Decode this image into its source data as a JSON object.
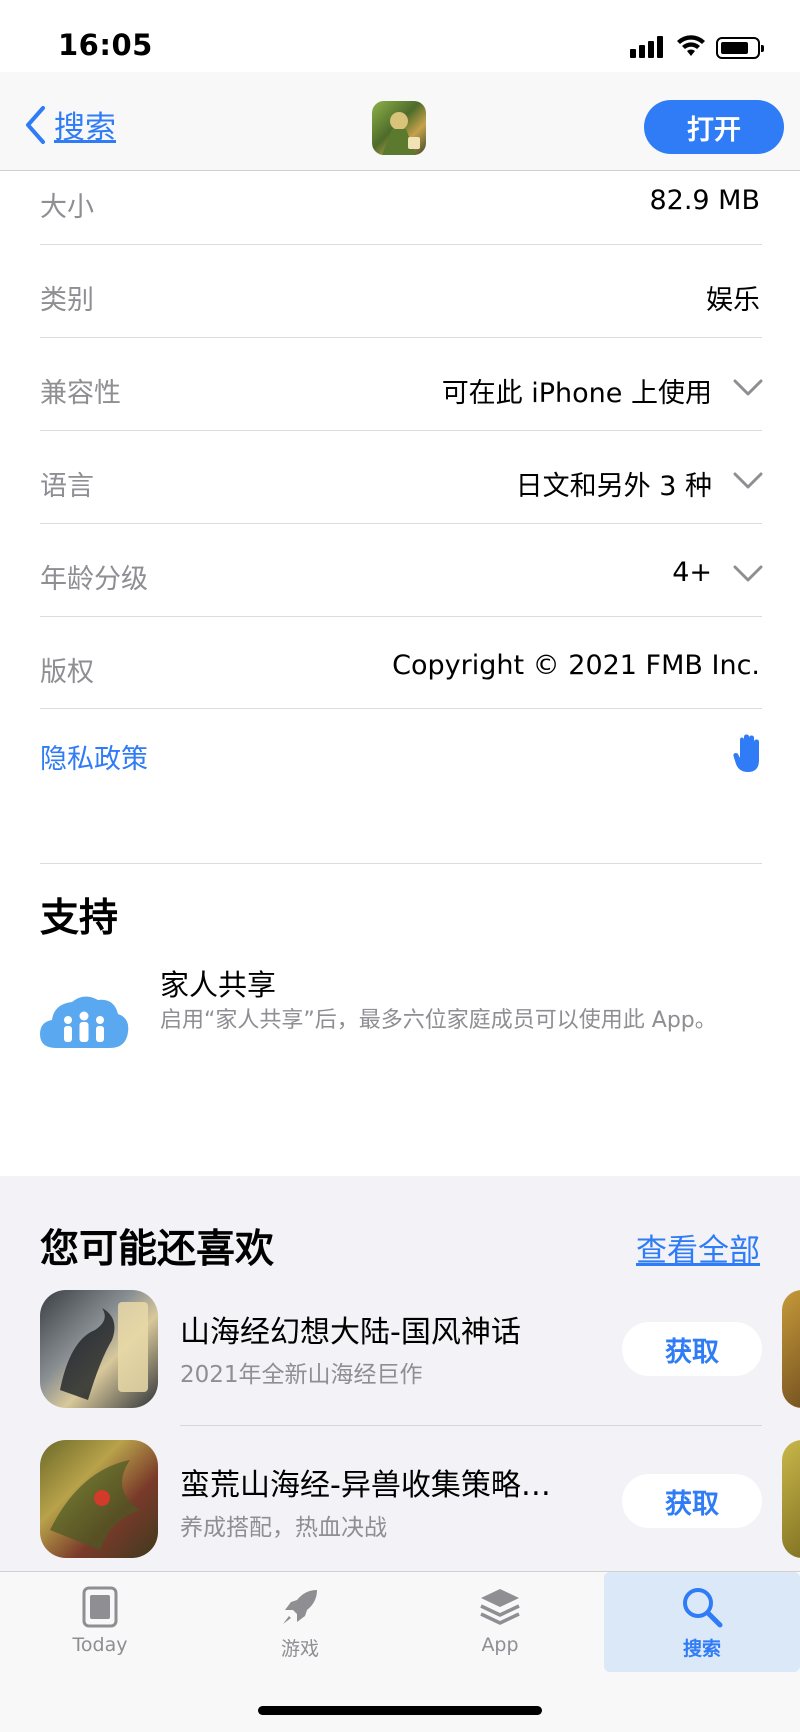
{
  "status_bar": {
    "time": "16:05"
  },
  "nav": {
    "back_label": "搜索",
    "open_label": "打开"
  },
  "info": {
    "rows": [
      {
        "label": "大小",
        "value": "82.9 MB"
      },
      {
        "label": "类别",
        "value": "娱乐"
      },
      {
        "label": "兼容性",
        "value": "可在此 iPhone 上使用"
      },
      {
        "label": "语言",
        "value": "日文和另外 3 种"
      },
      {
        "label": "年龄分级",
        "value": "4+"
      },
      {
        "label": "版权",
        "value": "Copyright © 2021 FMB Inc."
      }
    ],
    "privacy_label": "隐私政策"
  },
  "support": {
    "title": "支持",
    "family_title": "家人共享",
    "family_desc": "启用“家人共享”后，最多六位家庭成员可以使用此 App。"
  },
  "recommended": {
    "title": "您可能还喜欢",
    "see_all": "查看全部",
    "apps": [
      {
        "name": "山海经幻想大陆-国风神话",
        "subtitle": "2021年全新山海经巨作",
        "button": "获取"
      },
      {
        "name": "蛮荒山海经-异兽收集策略…",
        "subtitle": "养成搭配，热血决战",
        "button": "获取"
      }
    ]
  },
  "tabs": [
    {
      "label": "Today"
    },
    {
      "label": "游戏"
    },
    {
      "label": "App"
    },
    {
      "label": "搜索"
    }
  ],
  "colors": {
    "accent": "#2f7cf6",
    "secondary_text": "#8e8e93",
    "section_bg": "#f2f2f7"
  }
}
